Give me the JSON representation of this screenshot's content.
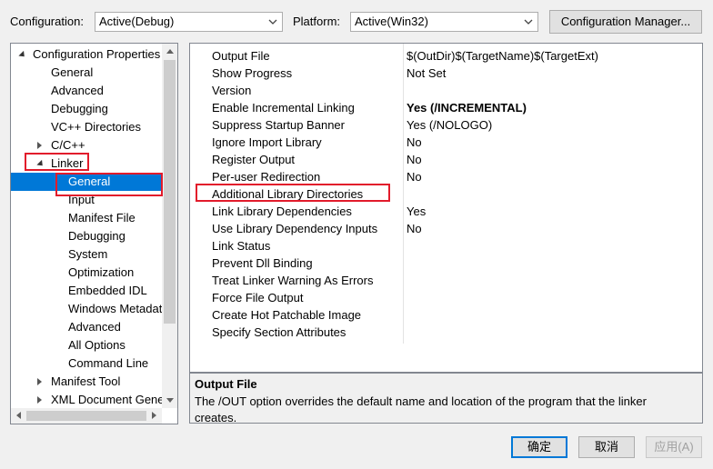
{
  "header": {
    "configuration_label": "Configuration:",
    "configuration_value": "Active(Debug)",
    "platform_label": "Platform:",
    "platform_value": "Active(Win32)",
    "config_manager_button": "Configuration Manager..."
  },
  "tree": {
    "items": [
      {
        "label": "Configuration Properties",
        "expander": "expanded"
      },
      {
        "label": "General"
      },
      {
        "label": "Advanced"
      },
      {
        "label": "Debugging"
      },
      {
        "label": "VC++ Directories"
      },
      {
        "label": "C/C++",
        "expander": "collapsed"
      },
      {
        "label": "Linker",
        "expander": "expanded"
      },
      {
        "label": "General",
        "selected": true
      },
      {
        "label": "Input"
      },
      {
        "label": "Manifest File"
      },
      {
        "label": "Debugging"
      },
      {
        "label": "System"
      },
      {
        "label": "Optimization"
      },
      {
        "label": "Embedded IDL"
      },
      {
        "label": "Windows Metadata"
      },
      {
        "label": "Advanced"
      },
      {
        "label": "All Options"
      },
      {
        "label": "Command Line"
      },
      {
        "label": "Manifest Tool",
        "expander": "collapsed"
      },
      {
        "label": "XML Document Generator",
        "expander": "collapsed"
      }
    ]
  },
  "grid": {
    "rows": [
      {
        "name": "Output File",
        "value": "$(OutDir)$(TargetName)$(TargetExt)"
      },
      {
        "name": "Show Progress",
        "value": "Not Set"
      },
      {
        "name": "Version",
        "value": ""
      },
      {
        "name": "Enable Incremental Linking",
        "value": "Yes (/INCREMENTAL)",
        "bold": true
      },
      {
        "name": "Suppress Startup Banner",
        "value": "Yes (/NOLOGO)"
      },
      {
        "name": "Ignore Import Library",
        "value": "No"
      },
      {
        "name": "Register Output",
        "value": "No"
      },
      {
        "name": "Per-user Redirection",
        "value": "No"
      },
      {
        "name": "Additional Library Directories",
        "value": ""
      },
      {
        "name": "Link Library Dependencies",
        "value": "Yes"
      },
      {
        "name": "Use Library Dependency Inputs",
        "value": "No"
      },
      {
        "name": "Link Status",
        "value": ""
      },
      {
        "name": "Prevent Dll Binding",
        "value": ""
      },
      {
        "name": "Treat Linker Warning As Errors",
        "value": ""
      },
      {
        "name": "Force File Output",
        "value": ""
      },
      {
        "name": "Create Hot Patchable Image",
        "value": ""
      },
      {
        "name": "Specify Section Attributes",
        "value": ""
      }
    ]
  },
  "description": {
    "title": "Output File",
    "text": "The /OUT option overrides the default name and location of the program that the linker creates."
  },
  "footer": {
    "ok_button": "确定",
    "cancel_button": "取消",
    "apply_button": "应用(A)"
  },
  "colors": {
    "selection": "#0078d7",
    "highlight_box": "#e21b2b"
  }
}
